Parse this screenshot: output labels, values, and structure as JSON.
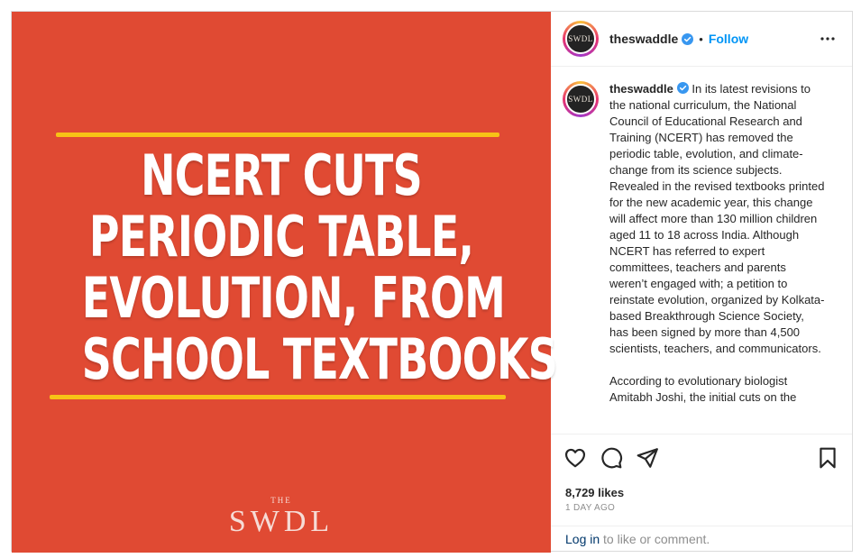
{
  "post": {
    "headline_lines": [
      "NCERT CUTS",
      "PERIODIC TABLE,",
      "EVOLUTION, FROM",
      "SCHOOL TEXTBOOKS"
    ],
    "brand_small": "THE",
    "brand_large": "SWDL",
    "colors": {
      "background": "#e04a33",
      "rule": "#f7c316",
      "headline": "#ffffff"
    }
  },
  "header": {
    "avatar_text": "SWDL",
    "username": "theswaddle",
    "separator": "•",
    "follow_label": "Follow",
    "more_icon": "more-horizontal-icon"
  },
  "caption": {
    "username": "theswaddle",
    "text": "In its latest revisions to the national curriculum, the National Council of Educational Research and Training (NCERT) has removed the periodic table, evolution, and climate-change from its science subjects. Revealed in the revised textbooks printed for the new academic year, this change will affect more than 130 million children aged 11 to 18 across India. Although NCERT has referred to expert committees, teachers and parents weren’t engaged with; a petition to reinstate evolution, organized by Kolkata-based Breakthrough Science Society, has been signed by more than 4,500 scientists, teachers, and communicators.",
    "text2": "According to evolutionary biologist Amitabh Joshi, the initial cuts on the"
  },
  "actions": {
    "icons": [
      "heart-icon",
      "comment-icon",
      "share-icon",
      "bookmark-icon"
    ],
    "likes": "8,729 likes",
    "time": "1 DAY AGO"
  },
  "comment": {
    "login_label": "Log in",
    "prompt": " to like or comment."
  },
  "colors": {
    "accent": "#0095f6",
    "verified": "#3897f0",
    "muted": "#8e8e8e",
    "link": "#00376b"
  }
}
